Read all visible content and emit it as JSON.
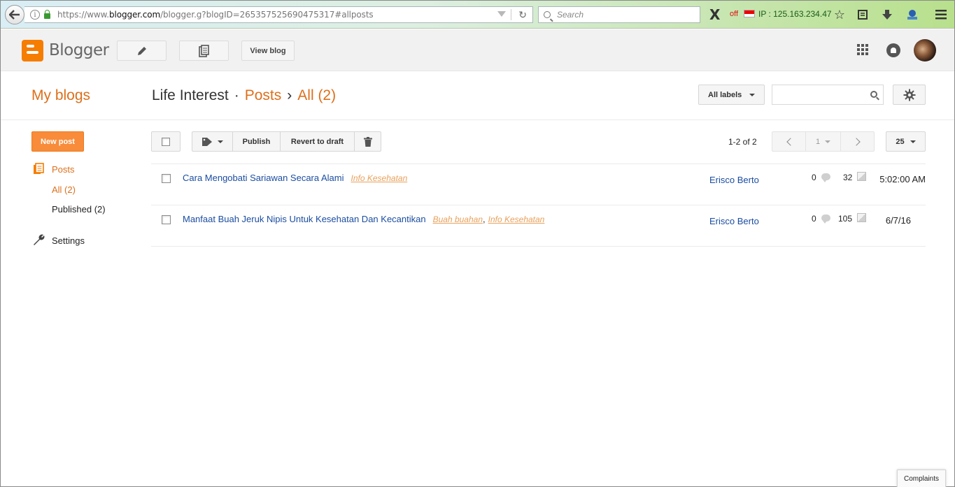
{
  "browser": {
    "url_prefix": "https://www.",
    "url_domain": "blogger.com",
    "url_rest": "/blogger.g?blogID=2653575256904753​17#allposts",
    "search_placeholder": "Search",
    "addon_x": "X",
    "addon_off": "off",
    "ip_text": "IP : 125.163.234.47"
  },
  "header": {
    "logo_text": "Blogger",
    "view_blog": "View blog"
  },
  "titlebar": {
    "my_blogs": "My blogs",
    "blog_name": "Life Interest",
    "dot": "·",
    "posts": "Posts",
    "arrow": "›",
    "all": "All (2)",
    "all_labels": "All labels"
  },
  "nav": {
    "new_post": "New post",
    "posts": "Posts",
    "all": "All (2)",
    "published": "Published (2)",
    "settings": "Settings"
  },
  "toolbar": {
    "publish": "Publish",
    "revert": "Revert to draft",
    "count": "1-2 of 2",
    "page": "1",
    "per_page": "25"
  },
  "posts": [
    {
      "title": "Cara Mengobati Sariawan Secara Alami",
      "labels": [
        "Info Kesehatan"
      ],
      "author": "Erisco Berto",
      "comments": "0",
      "views": "32",
      "date": "5:02:00 AM"
    },
    {
      "title": "Manfaat Buah Jeruk Nipis Untuk Kesehatan Dan Kecantikan",
      "labels": [
        "Buah buahan",
        "Info Kesehatan"
      ],
      "author": "Erisco Berto",
      "comments": "0",
      "views": "105",
      "date": "6/7/16"
    }
  ],
  "footer": {
    "complaints": "Complaints"
  }
}
